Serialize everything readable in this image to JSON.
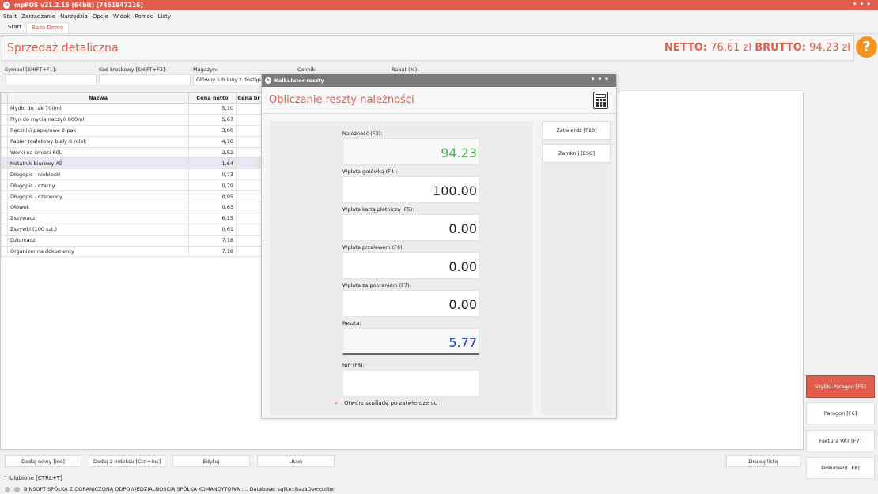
{
  "window": {
    "title": "mpPOS v21.2.15 (64bit) [7451847216]"
  },
  "menu": [
    "Start",
    "Zarządzanie",
    "Narzędzia",
    "Opcje",
    "Widok",
    "Pomoc",
    "Listy"
  ],
  "tabs": [
    "Start",
    "Baza Demo"
  ],
  "header": {
    "title": "Sprzedaż detaliczna",
    "netto_label": "NETTO:",
    "netto_value": "76,61 zł",
    "brutto_label": "BRUTTO:",
    "brutto_value": "94,23 zł"
  },
  "help_label": "?",
  "filters": {
    "symbol_label": "Symbol [SHIFT+F1]:",
    "barcode_label": "Kod kreskowy [SHIFT+F2]:",
    "warehouse_label": "Magazyn:",
    "warehouse_value": "Główny lub inny z dostępnym",
    "pricelist_label": "Cennik:",
    "discount_label": "Rabat (%):"
  },
  "table": {
    "headers": [
      "Nazwa",
      "Cena netto",
      "Cena br"
    ],
    "rows": [
      [
        "Mydło do rąk 700ml",
        "5,10"
      ],
      [
        "Płyn do mycia naczyń 800ml",
        "5,67"
      ],
      [
        "Ręczniki papierowe 2-pak",
        "3,00"
      ],
      [
        "Papier toaletowy biały 8 rolek",
        "4,78"
      ],
      [
        "Worki na śmieci 60L",
        "2,52"
      ],
      [
        "Notatnik biurowy A5",
        "1,64"
      ],
      [
        "Długopis - niebieski",
        "0,73"
      ],
      [
        "Długopis - czarny",
        "0,79"
      ],
      [
        "Długopis - czerwony",
        "0,95"
      ],
      [
        "Ołówek",
        "0,63"
      ],
      [
        "Zszywacz",
        "6,15"
      ],
      [
        "Zszywki (100 szt.)",
        "0,61"
      ],
      [
        "Dziurkacz",
        "7,18"
      ],
      [
        "Organizer na dokumenty",
        "7,18"
      ]
    ]
  },
  "bottom_buttons": {
    "add_new": "Dodaj nowy [Ins]",
    "add_index": "Dodaj z indeksu [Ctrl+Ins]",
    "edit": "Edytuj",
    "delete": "Usuń",
    "print": "Drukuj listę"
  },
  "favorites": "Ulubione [CTRL+T]",
  "status": "BINSOFT SPÓŁKA Z OGRANICZONĄ ODPOWIEDZIALNOŚCIĄ SPÓŁKA KOMANDYTOWA :... Database: sqlite::BazaDemo.dbx",
  "side_buttons": {
    "quick_receipt": "Szybki Paragon [F5]",
    "receipt": "Paragon [F6]",
    "invoice": "Faktura VAT [F7]",
    "document": "Dokument [F8]"
  },
  "dialog": {
    "title": "Kalkulator reszty",
    "heading": "Obliczanie reszty należności",
    "due_label": "Należność (F3):",
    "due_value": "94.23",
    "cash_label": "Wpłata gotówką (F4):",
    "cash_value": "100.00",
    "card_label": "Wpłata kartą płatniczą (F5):",
    "card_value": "0.00",
    "transfer_label": "Wpłata przelewem (F6):",
    "transfer_value": "0.00",
    "cod_label": "Wpłata za pobraniem (F7):",
    "cod_value": "0.00",
    "change_label": "Reszta:",
    "change_value": "5.77",
    "nip_label": "NIP (F8):",
    "nip_value": "",
    "drawer_label": "Otwórz szufladę po zatwierdzeniu",
    "confirm_label": "Zatwierdź [F10]",
    "close_label": "Zamknij [ESC]"
  },
  "colors": {
    "accent": "#e05c4c",
    "due_green": "#4caf50",
    "change_blue": "#1a3fd6",
    "help_orange": "#f4931e"
  }
}
